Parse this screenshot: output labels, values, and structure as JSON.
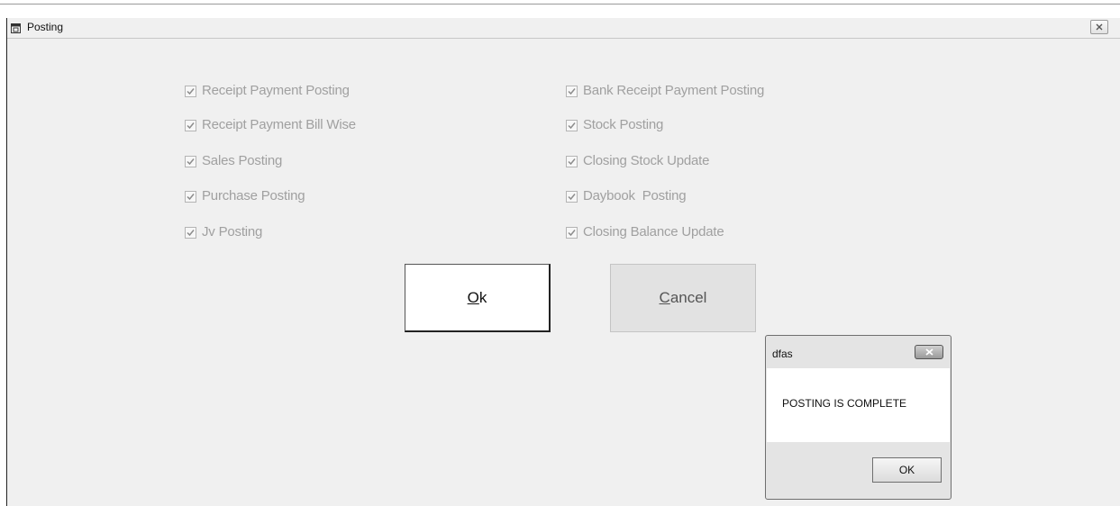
{
  "window": {
    "title": "Posting"
  },
  "checkboxes_left": [
    {
      "label": "Receipt Payment Posting",
      "checked": true
    },
    {
      "label": "Receipt Payment Bill Wise",
      "checked": true
    },
    {
      "label": "Sales Posting",
      "checked": true
    },
    {
      "label": "Purchase Posting",
      "checked": true
    },
    {
      "label": "Jv Posting",
      "checked": true
    }
  ],
  "checkboxes_right": [
    {
      "label": "Bank Receipt Payment Posting",
      "checked": true
    },
    {
      "label": "Stock Posting",
      "checked": true
    },
    {
      "label": "Closing Stock Update",
      "checked": true
    },
    {
      "label": "Daybook  Posting",
      "checked": true
    },
    {
      "label": "Closing Balance Update",
      "checked": true
    }
  ],
  "buttons": {
    "ok": {
      "mnemonic": "O",
      "rest": "k"
    },
    "cancel": {
      "mnemonic": "C",
      "rest": "ancel"
    }
  },
  "dialog": {
    "title": "dfas",
    "message": "POSTING IS COMPLETE",
    "ok_label": "OK"
  },
  "colors": {
    "window_bg": "#f0f0f0",
    "disabled_text": "#a0a0a0",
    "dialog_body": "#ffffff"
  }
}
